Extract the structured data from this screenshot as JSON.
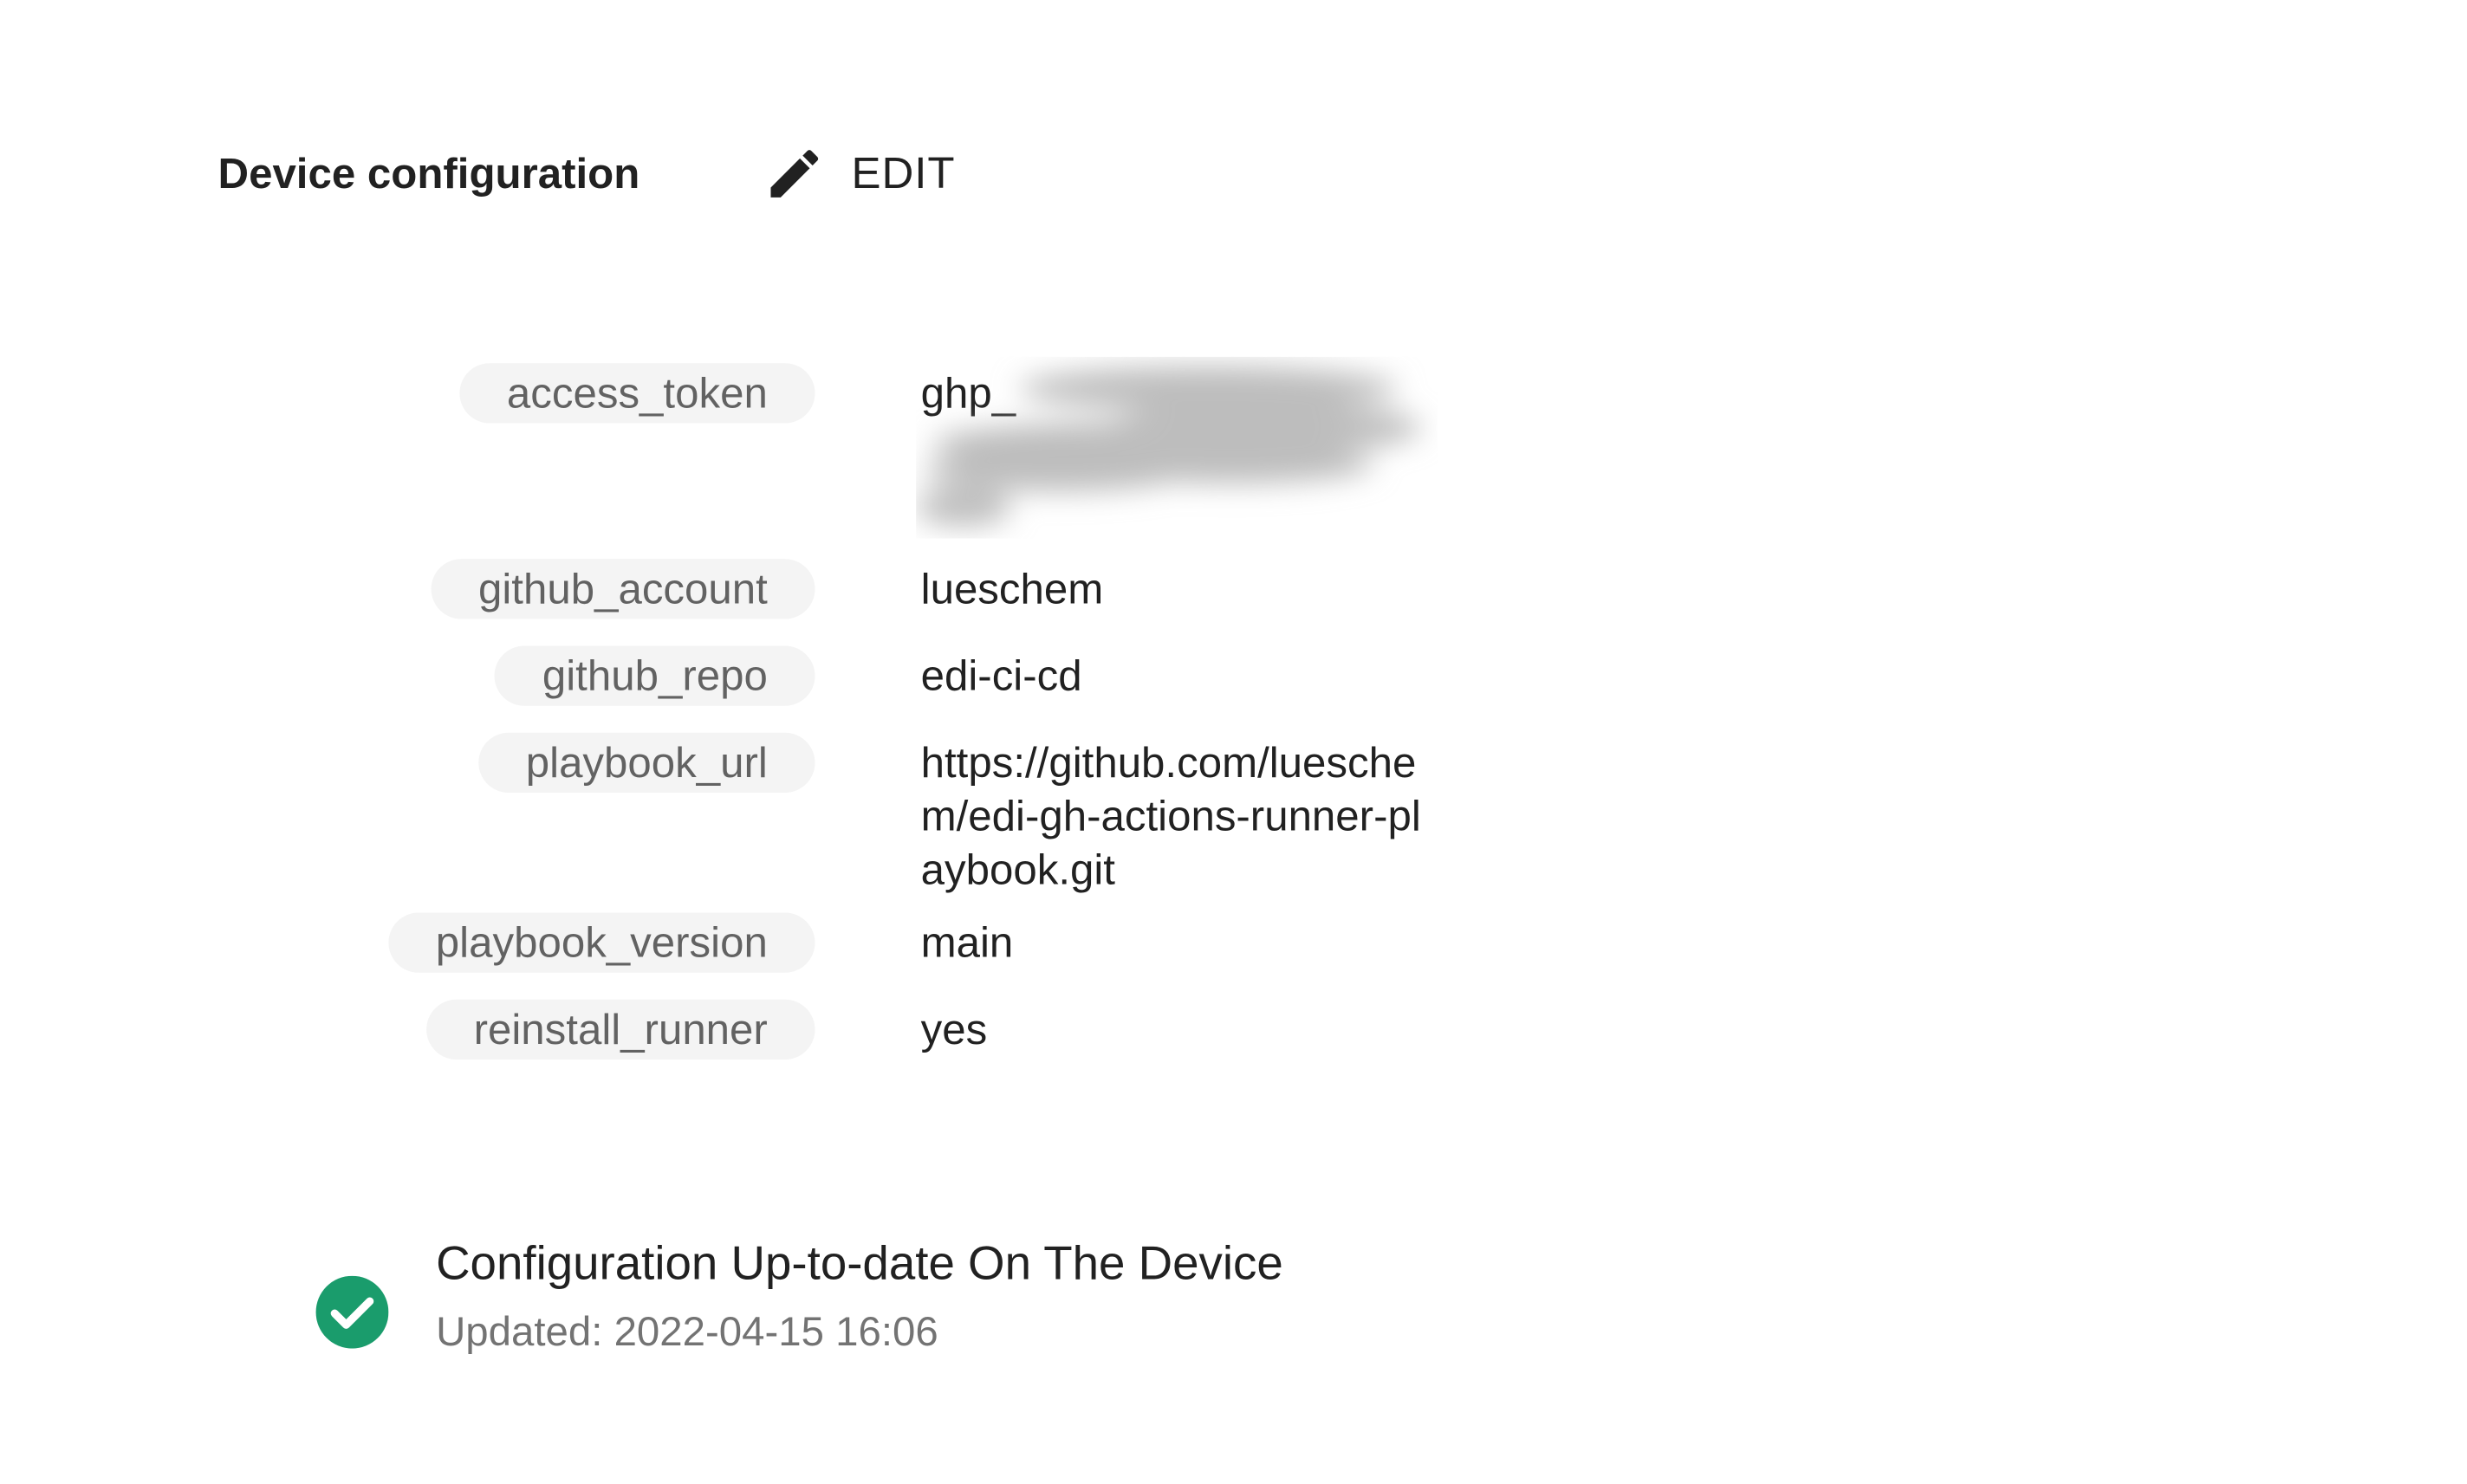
{
  "header": {
    "title": "Device configuration",
    "edit_label": "EDIT"
  },
  "config": {
    "entries": [
      {
        "key": "access_token",
        "value": "ghp_",
        "redacted": true
      },
      {
        "key": "github_account",
        "value": "lueschem"
      },
      {
        "key": "github_repo",
        "value": "edi-ci-cd"
      },
      {
        "key": "playbook_url",
        "value": "https://github.com/lueschem/edi-gh-actions-runner-playbook.git"
      },
      {
        "key": "playbook_version",
        "value": "main"
      },
      {
        "key": "reinstall_runner",
        "value": "yes"
      }
    ]
  },
  "status": {
    "icon": "check-circle-icon",
    "color": "#1a9c6c",
    "title": "Configuration Up-to-date On The Device",
    "updated": "Updated: 2022-04-15 16:06"
  }
}
